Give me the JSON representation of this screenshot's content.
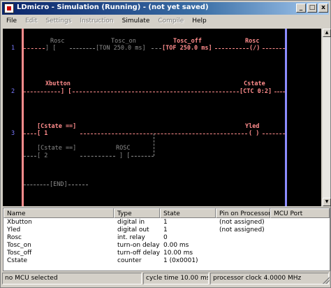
{
  "window": {
    "title": "LDmicro - Simulation (Running) - (not yet saved)",
    "controls": {
      "minimize": "_",
      "maximize": "□",
      "close": "x"
    }
  },
  "menu": [
    "File",
    "Edit",
    "Settings",
    "Instruction",
    "Simulate",
    "Compile",
    "Help"
  ],
  "menu_disabled": [
    "Edit",
    "Settings",
    "Instruction",
    "Compile"
  ],
  "ladder": {
    "rungs": [
      {
        "number": "1",
        "elements": [
          {
            "label": "Rosc",
            "symbol": "] ["
          },
          {
            "label": "Tosc_on",
            "symbol": "[TON 250.0 ms]"
          },
          {
            "label": "Tosc_off",
            "symbol": "[TOF 250.0 ms]"
          },
          {
            "label": "Rosc",
            "symbol": "(/)"
          }
        ]
      },
      {
        "number": "2",
        "elements": [
          {
            "label": "Xbutton",
            "symbol": "] ["
          },
          {
            "label": "Cstate",
            "symbol": "[CTC 0:2]"
          }
        ]
      },
      {
        "number": "3",
        "elements": [
          {
            "label": "[Cstate ==]",
            "symbol": "[ 1"
          },
          {
            "label": "Yled",
            "symbol": "( )"
          },
          {
            "label": "[Cstate ==]",
            "symbol": "[ 2"
          },
          {
            "label": "ROSC",
            "symbol": "] ["
          }
        ]
      }
    ],
    "end_label": "[END]"
  },
  "io_list": {
    "columns": [
      "Name",
      "Type",
      "State",
      "Pin on Processor",
      "MCU Port"
    ],
    "rows": [
      [
        "Xbutton",
        "digital in",
        "1",
        "(not assigned)",
        ""
      ],
      [
        "Yled",
        "digital out",
        "1",
        "(not assigned)",
        ""
      ],
      [
        "Rosc",
        "int. relay",
        "0",
        "",
        ""
      ],
      [
        "Tosc_on",
        "turn-on delay",
        "0.00 ms",
        "",
        ""
      ],
      [
        "Tosc_off",
        "turn-off delay",
        "10.00 ms",
        "",
        ""
      ],
      [
        "Cstate",
        "counter",
        "1 (0x0001)",
        "",
        ""
      ]
    ]
  },
  "status": {
    "mcu": "no MCU selected",
    "cycle": "cycle time 10.00 ms",
    "clock": "processor clock 4.0000 MHz"
  },
  "colors": {
    "canvas_bg": "#000000",
    "energized": "#ff8c8c",
    "de_energized": "#8c8c8c",
    "rung_number": "#7878ff",
    "right_rail": "#8c8cff"
  }
}
